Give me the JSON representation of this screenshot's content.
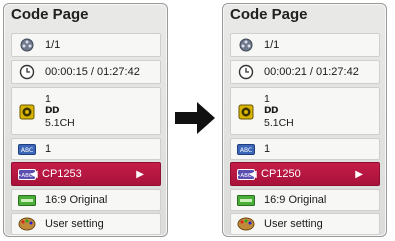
{
  "left_panel": {
    "title": "Code Page",
    "title_number": "1/1",
    "time": "00:00:15 / 01:27:42",
    "audio": {
      "number": "1",
      "codec": "DD",
      "channels": "5.1CH"
    },
    "subtitle_number": "1",
    "code_page": "CP1253",
    "aspect": "16:9 Original",
    "user": "User setting"
  },
  "right_panel": {
    "title": "Code Page",
    "title_number": "1/1",
    "time": "00:00:21 / 01:27:42",
    "audio": {
      "number": "1",
      "codec": "DD",
      "channels": "5.1CH"
    },
    "subtitle_number": "1",
    "code_page": "CP1250",
    "aspect": "16:9 Original",
    "user": "User setting"
  },
  "icons": {
    "title": "film-reel-icon",
    "time": "clock-icon",
    "audio": "speaker-icon",
    "subtitle": "abc-subtitle-icon",
    "code_page": "abc-codepage-icon",
    "aspect": "aspect-ratio-icon",
    "user": "palette-icon",
    "transition": "right-arrow-icon"
  },
  "colors": {
    "selected": "#b8173f",
    "panel_bg": "#e3e3e1",
    "row_bg": "#f7f7f5"
  }
}
